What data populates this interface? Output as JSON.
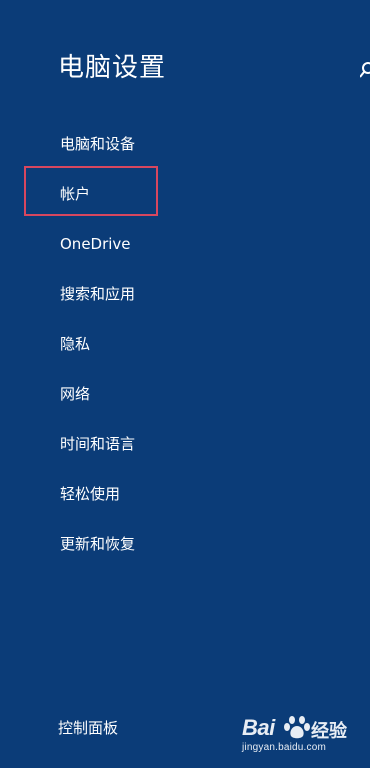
{
  "window": {
    "title": "电脑设置"
  },
  "nav": {
    "items": [
      {
        "label": "电脑和设备"
      },
      {
        "label": "帐户"
      },
      {
        "label": "OneDrive"
      },
      {
        "label": "搜索和应用"
      },
      {
        "label": "隐私"
      },
      {
        "label": "网络"
      },
      {
        "label": "时间和语言"
      },
      {
        "label": "轻松使用"
      },
      {
        "label": "更新和恢复"
      }
    ],
    "selected_index": 1
  },
  "footer": {
    "control_panel": "控制面板"
  },
  "watermark": {
    "brand_text_left": "Bai",
    "brand_text_right": "经验",
    "url": "jingyan.baidu.com"
  },
  "icons": {
    "search": "search-icon",
    "paw": "paw-icon"
  },
  "colors": {
    "background": "#0b3c78",
    "text": "#ffffff",
    "highlight_border": "#d8475f"
  }
}
